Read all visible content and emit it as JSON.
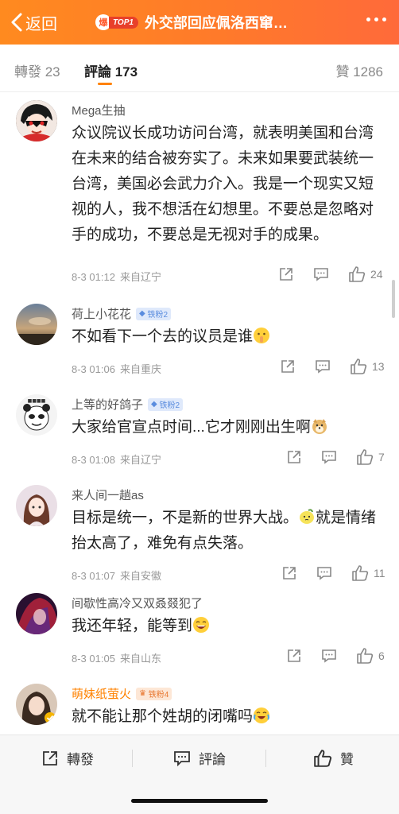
{
  "header": {
    "back_label": "返回",
    "hot_badge": "TOP1",
    "hot_char": "爆",
    "title": "外交部回应佩洛西窜…",
    "accent": "#ff8200"
  },
  "tabs": {
    "repost": "轉發 23",
    "comment": "評論 173",
    "like": "贊 1286"
  },
  "comments": [
    {
      "user": "Mega生抽",
      "badge": "",
      "text": "众议院议长成功访问台湾，就表明美国和台湾在未来的结合被夯实了。未来如果要武装统一台湾，美国必会武力介入。我是一个现实又短视的人，我不想活在幻想里。不要总是忽略对手的成功，不要总是无视对手的成果。",
      "time": "8-3 01:12",
      "location": "来自辽宁",
      "likes": "24"
    },
    {
      "user": "荷上小花花",
      "badge": "铁粉2",
      "text": "不如看下一个去的议员是谁",
      "emoji": "shush-emoji",
      "time": "8-3 01:06",
      "location": "来自重庆",
      "likes": "13"
    },
    {
      "user": "上等的好鸽子",
      "badge": "铁粉2",
      "text": "大家给官宣点时间...它才刚刚出生啊",
      "emoji": "doge-emoji",
      "time": "8-3 01:08",
      "location": "来自辽宁",
      "likes": "7"
    },
    {
      "user": "来人间一趟as",
      "badge": "",
      "text_a": "目标是统一，不是新的世界大战。",
      "text_b": "就是情绪抬太高了，难免有点失落。",
      "emoji": "lemon-emoji",
      "time": "8-3 01:07",
      "location": "来自安徽",
      "likes": "11"
    },
    {
      "user": "间歇性高冷又双叒叕犯了",
      "badge": "",
      "text": "我还年轻，能等到",
      "emoji": "laugh-emoji",
      "time": "8-3 01:05",
      "location": "来自山东",
      "likes": "6"
    },
    {
      "user": "萌妹纸萤火",
      "badge": "铁粉4",
      "text": "就不能让那个姓胡的闭嘴吗",
      "emoji": "laugh-cry-emoji",
      "time": "",
      "location": "",
      "likes": ""
    }
  ],
  "bottom_bar": {
    "repost": "轉發",
    "comment": "評論",
    "like": "贊"
  }
}
